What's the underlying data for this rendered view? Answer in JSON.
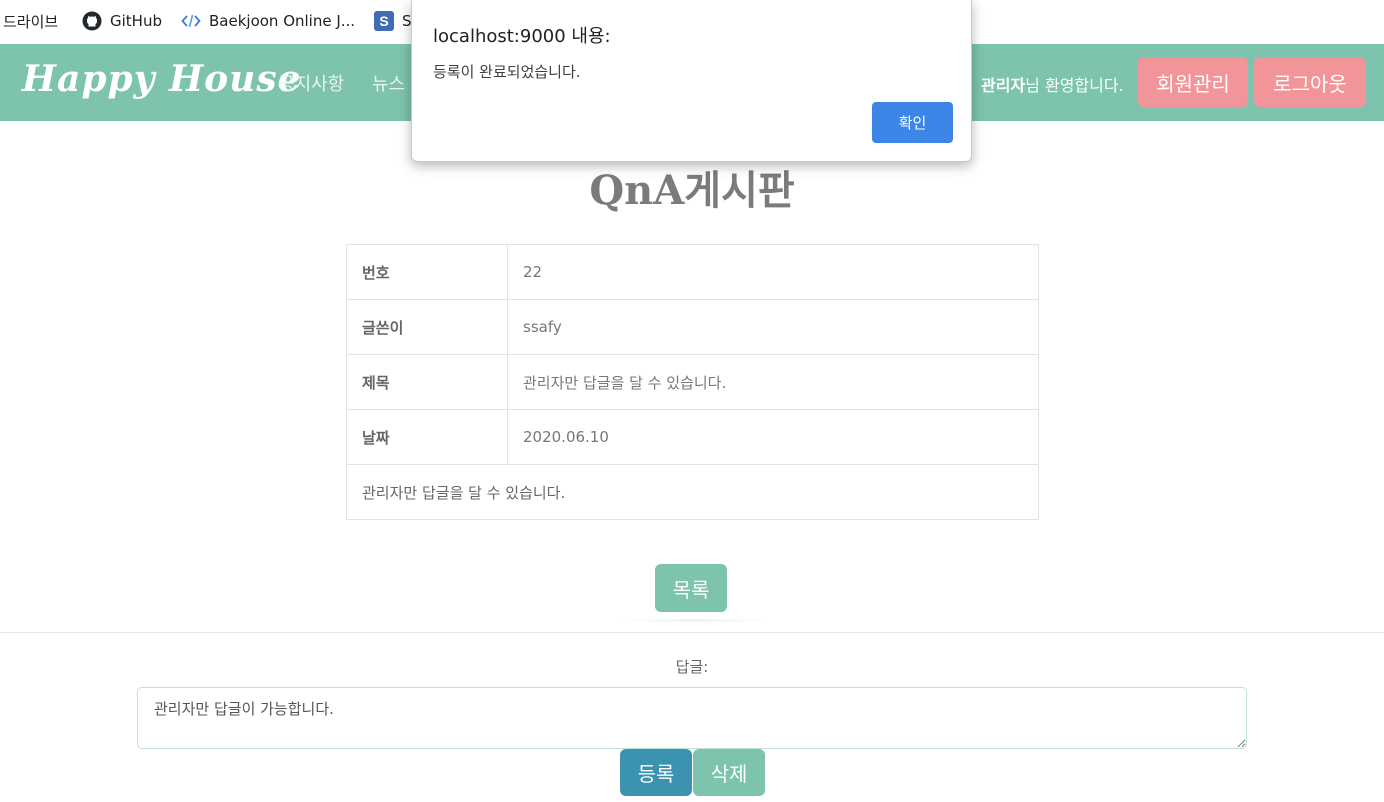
{
  "bookmarks": [
    {
      "label": "드라이브",
      "icon": "drive-icon"
    },
    {
      "label": "GitHub",
      "icon": "github-icon"
    },
    {
      "label": "Baekjoon Online J...",
      "icon": "code-icon"
    },
    {
      "label": "S",
      "icon": "s-logo-icon"
    }
  ],
  "navbar": {
    "brand": "Happy House",
    "links": [
      "공지사항",
      "뉴스"
    ],
    "welcome_user": "관리자",
    "welcome_suffix": "님 환영합니다.",
    "members_button": "회원관리",
    "logout_button": "로그아웃"
  },
  "page": {
    "title": "QnA게시판",
    "rows": [
      {
        "label": "번호",
        "value": "22"
      },
      {
        "label": "글쓴이",
        "value": "ssafy"
      },
      {
        "label": "제목",
        "value": "관리자만 답글을 달 수 있습니다."
      },
      {
        "label": "날짜",
        "value": "2020.06.10"
      }
    ],
    "content": "관리자만 답글을 달 수 있습니다.",
    "list_button": "목록"
  },
  "reply": {
    "label": "답글:",
    "value": "관리자만 답글이 가능합니다.",
    "register_button": "등록",
    "delete_button": "삭제"
  },
  "dialog": {
    "title": "localhost:9000 내용:",
    "message": "등록이 완료되었습니다.",
    "ok_button": "확인"
  },
  "colors": {
    "navbar": "#7dc3ae",
    "pink_button": "#f2959a",
    "register_button": "#3b93b0",
    "dialog_ok": "#3d86e8"
  }
}
